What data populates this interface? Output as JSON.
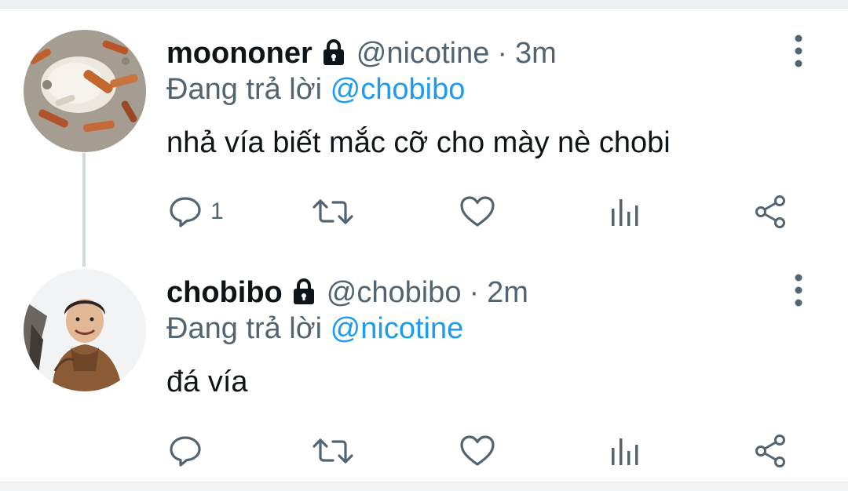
{
  "tweets": [
    {
      "display_name": "moononer",
      "handle": "@nicotine",
      "separator": "·",
      "time": "3m",
      "reply_prefix": "Đang trả lời",
      "reply_to": "@chobibo",
      "text": "nhả vía biết mắc cỡ cho mày nè chobi",
      "reply_count": "1",
      "avatar_icon": "avatar-image",
      "locked": true
    },
    {
      "display_name": "chobibo",
      "handle": "@chobibo",
      "separator": "·",
      "time": "2m",
      "reply_prefix": "Đang trả lời",
      "reply_to": "@nicotine",
      "text": "đá vía",
      "reply_count": "",
      "avatar_icon": "avatar-image",
      "locked": true
    }
  ],
  "colors": {
    "text_primary": "#0f1419",
    "text_secondary": "#536471",
    "link": "#1d9bf0",
    "thread_line": "#cfd9de"
  },
  "icons": [
    "lock-icon",
    "more-icon",
    "reply-icon",
    "retweet-icon",
    "like-icon",
    "analytics-icon",
    "share-icon"
  ]
}
